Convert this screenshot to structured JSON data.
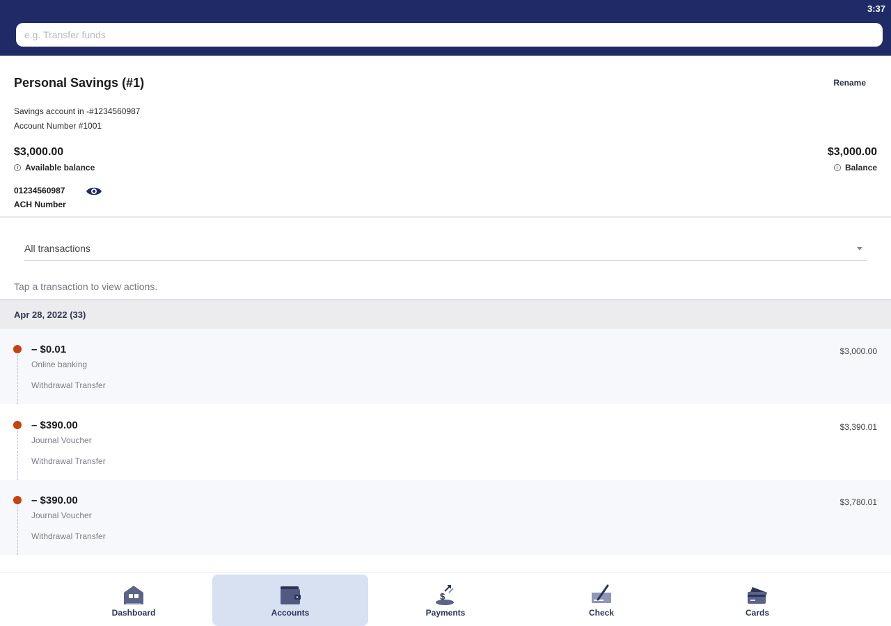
{
  "status_bar": {
    "time": "3:37"
  },
  "search": {
    "placeholder": "e.g. Transfer funds"
  },
  "account": {
    "title": "Personal Savings (#1)",
    "rename_label": "Rename",
    "savings_line": "Savings account in -#1234560987",
    "account_number_line": "Account Number #1001",
    "available_balance": "$3,000.00",
    "available_balance_label": "Available balance",
    "balance": "$3,000.00",
    "balance_label": "Balance",
    "ach_number": "01234560987",
    "ach_label": "ACH Number"
  },
  "filter": {
    "selected": "All transactions"
  },
  "hint": "Tap a transaction to view actions.",
  "date_group": {
    "label": "Apr 28, 2022 (33)"
  },
  "transactions": [
    {
      "amount": "– $0.01",
      "source": "Online banking",
      "type": "Withdrawal Transfer",
      "balance": "$3,000.00"
    },
    {
      "amount": "– $390.00",
      "source": "Journal Voucher",
      "type": "Withdrawal Transfer",
      "balance": "$3,390.01"
    },
    {
      "amount": "– $390.00",
      "source": "Journal Voucher",
      "type": "Withdrawal Transfer",
      "balance": "$3,780.01"
    }
  ],
  "bottom_nav": {
    "items": [
      {
        "label": "Dashboard",
        "icon": "home-icon"
      },
      {
        "label": "Accounts",
        "icon": "wallet-icon",
        "active": true
      },
      {
        "label": "Payments",
        "icon": "payments-icon"
      },
      {
        "label": "Check",
        "icon": "check-deposit-icon"
      },
      {
        "label": "Cards",
        "icon": "card-icon"
      }
    ]
  },
  "colors": {
    "header": "#1f2a66",
    "debit_dot": "#c8410f",
    "nav_active": "#d8e1f1"
  }
}
